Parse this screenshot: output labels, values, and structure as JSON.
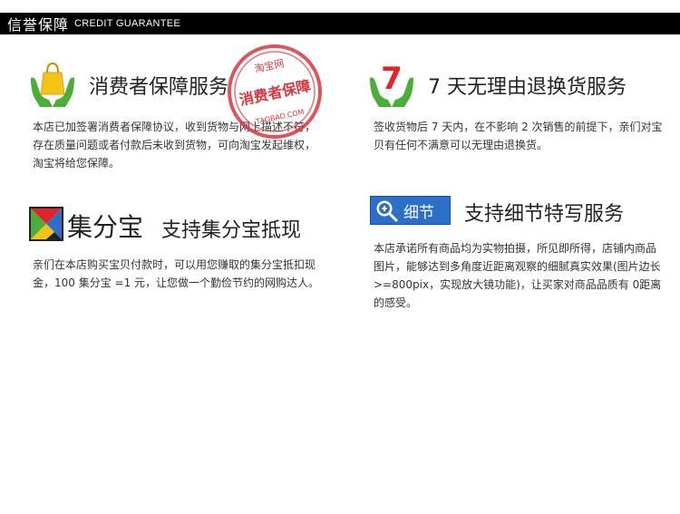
{
  "header": {
    "title_zh": "信誉保障",
    "title_en": "CREDIT GUARANTEE"
  },
  "blocks": {
    "consumer": {
      "title": "消费者保障服务",
      "desc": "本店已加签署消费者保障协议，收到货物与网上描述不符，存在质量问题或者付款后未收到货物，可向淘宝发起维权，淘宝将给您保障。"
    },
    "return": {
      "title": "7 天无理由退换货服务",
      "desc": "签收货物后 7 天内，在不影响 2 次销售的前提下，亲们对宝贝有任何不满意可以无理由退换货。"
    },
    "jifen": {
      "logo_text": "集分宝",
      "title": "支持集分宝抵现",
      "desc": "亲们在本店购买宝贝付款时，可以用您赚取的集分宝抵扣现金，100 集分宝 =1 元，让您做一个勤俭节约的网购达人。"
    },
    "detail": {
      "tag_text": "细节",
      "title": "支持细节特写服务",
      "desc": "本店承诺所有商品均为实物拍摄，所见即所得，店铺内商品图片，能够达到多角度近距离观察的细腻真实效果(图片边长 >=800pix，实现放大镜功能)，让买家对商品品质有 0距离的感受。"
    }
  },
  "stamp": {
    "top_text": "淘宝网",
    "center_text": "消费者保障",
    "bottom_text": "TAOBAO.COM"
  },
  "colors": {
    "header_bg": "#000000",
    "stamp_red": "#d9363e",
    "hand_green": "#4cae3a",
    "bag_yellow": "#f2c418",
    "seven_red": "#e0242b",
    "tag_blue": "#2b6fc9"
  },
  "icons": {
    "consumer": "hands-with-shopping-bag-icon",
    "return": "hands-with-seven-icon",
    "jifen": "jifenbao-logo",
    "detail": "magnifier-icon"
  }
}
